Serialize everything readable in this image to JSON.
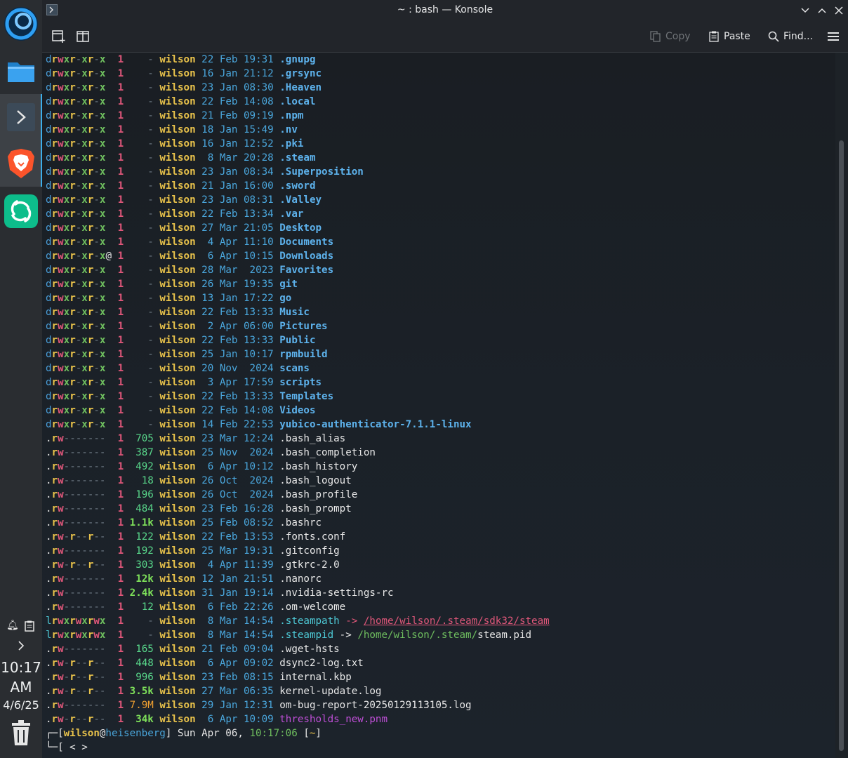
{
  "window": {
    "title": "~ : bash — Konsole",
    "toolbar": {
      "copy": "Copy",
      "paste": "Paste",
      "find": "Find..."
    }
  },
  "panel": {
    "apps": [
      {
        "name": "Dolphin",
        "icon": "folder-icon"
      },
      {
        "name": "Konsole",
        "icon": "terminal-icon"
      },
      {
        "name": "Brave",
        "icon": "brave-lion-icon"
      },
      {
        "name": "Element",
        "icon": "element-icon"
      }
    ],
    "clock": {
      "time": "10:17",
      "ampm": "AM",
      "date": "4/6/25"
    }
  },
  "listing": [
    {
      "p": [
        "d",
        "rwx",
        "r-x",
        "r-x"
      ],
      "n": "1",
      "size": "-",
      "user": "wilson",
      "day": "22",
      "mon": "Feb",
      "time": "19:31",
      "name": ".gnupg",
      "t": "dir"
    },
    {
      "p": [
        "d",
        "rwx",
        "r-x",
        "r-x"
      ],
      "n": "1",
      "size": "-",
      "user": "wilson",
      "day": "16",
      "mon": "Jan",
      "time": "21:12",
      "name": ".grsync",
      "t": "dir"
    },
    {
      "p": [
        "d",
        "rwx",
        "r-x",
        "r-x"
      ],
      "n": "1",
      "size": "-",
      "user": "wilson",
      "day": "23",
      "mon": "Jan",
      "time": "08:30",
      "name": ".Heaven",
      "t": "dir"
    },
    {
      "p": [
        "d",
        "rwx",
        "r-x",
        "r-x"
      ],
      "n": "1",
      "size": "-",
      "user": "wilson",
      "day": "22",
      "mon": "Feb",
      "time": "14:08",
      "name": ".local",
      "t": "dir"
    },
    {
      "p": [
        "d",
        "rwx",
        "r-x",
        "r-x"
      ],
      "n": "1",
      "size": "-",
      "user": "wilson",
      "day": "21",
      "mon": "Feb",
      "time": "09:19",
      "name": ".npm",
      "t": "dir"
    },
    {
      "p": [
        "d",
        "rwx",
        "r-x",
        "r-x"
      ],
      "n": "1",
      "size": "-",
      "user": "wilson",
      "day": "18",
      "mon": "Jan",
      "time": "15:49",
      "name": ".nv",
      "t": "dir"
    },
    {
      "p": [
        "d",
        "rwx",
        "r-x",
        "r-x"
      ],
      "n": "1",
      "size": "-",
      "user": "wilson",
      "day": "16",
      "mon": "Jan",
      "time": "12:52",
      "name": ".pki",
      "t": "dir"
    },
    {
      "p": [
        "d",
        "rwx",
        "r-x",
        "r-x"
      ],
      "n": "1",
      "size": "-",
      "user": "wilson",
      "day": " 8",
      "mon": "Mar",
      "time": "20:28",
      "name": ".steam",
      "t": "dir"
    },
    {
      "p": [
        "d",
        "rwx",
        "r-x",
        "r-x"
      ],
      "n": "1",
      "size": "-",
      "user": "wilson",
      "day": "23",
      "mon": "Jan",
      "time": "08:34",
      "name": ".Superposition",
      "t": "dir"
    },
    {
      "p": [
        "d",
        "rwx",
        "r-x",
        "r-x"
      ],
      "n": "1",
      "size": "-",
      "user": "wilson",
      "day": "21",
      "mon": "Jan",
      "time": "16:00",
      "name": ".sword",
      "t": "dir"
    },
    {
      "p": [
        "d",
        "rwx",
        "r-x",
        "r-x"
      ],
      "n": "1",
      "size": "-",
      "user": "wilson",
      "day": "23",
      "mon": "Jan",
      "time": "08:31",
      "name": ".Valley",
      "t": "dir"
    },
    {
      "p": [
        "d",
        "rwx",
        "r-x",
        "r-x"
      ],
      "n": "1",
      "size": "-",
      "user": "wilson",
      "day": "22",
      "mon": "Feb",
      "time": "13:34",
      "name": ".var",
      "t": "dir"
    },
    {
      "p": [
        "d",
        "rwx",
        "r-x",
        "r-x"
      ],
      "n": "1",
      "size": "-",
      "user": "wilson",
      "day": "27",
      "mon": "Mar",
      "time": "21:05",
      "name": "Desktop",
      "t": "dir"
    },
    {
      "p": [
        "d",
        "rwx",
        "r-x",
        "r-x"
      ],
      "n": "1",
      "size": "-",
      "user": "wilson",
      "day": " 4",
      "mon": "Apr",
      "time": "11:10",
      "name": "Documents",
      "t": "dir"
    },
    {
      "p": [
        "d",
        "rwx",
        "r-x",
        "r-x"
      ],
      "at": "@",
      "n": "1",
      "size": "-",
      "user": "wilson",
      "day": " 6",
      "mon": "Apr",
      "time": "10:15",
      "name": "Downloads",
      "t": "dir"
    },
    {
      "p": [
        "d",
        "rwx",
        "r-x",
        "r-x"
      ],
      "n": "1",
      "size": "-",
      "user": "wilson",
      "day": "28",
      "mon": "Mar",
      "time": " 2023",
      "name": "Favorites",
      "t": "dir"
    },
    {
      "p": [
        "d",
        "rwx",
        "r-x",
        "r-x"
      ],
      "n": "1",
      "size": "-",
      "user": "wilson",
      "day": "26",
      "mon": "Mar",
      "time": "19:35",
      "name": "git",
      "t": "dir"
    },
    {
      "p": [
        "d",
        "rwx",
        "r-x",
        "r-x"
      ],
      "n": "1",
      "size": "-",
      "user": "wilson",
      "day": "13",
      "mon": "Jan",
      "time": "17:22",
      "name": "go",
      "t": "dir"
    },
    {
      "p": [
        "d",
        "rwx",
        "r-x",
        "r-x"
      ],
      "n": "1",
      "size": "-",
      "user": "wilson",
      "day": "22",
      "mon": "Feb",
      "time": "13:33",
      "name": "Music",
      "t": "dir"
    },
    {
      "p": [
        "d",
        "rwx",
        "r-x",
        "r-x"
      ],
      "n": "1",
      "size": "-",
      "user": "wilson",
      "day": " 2",
      "mon": "Apr",
      "time": "06:00",
      "name": "Pictures",
      "t": "dir"
    },
    {
      "p": [
        "d",
        "rwx",
        "r-x",
        "r-x"
      ],
      "n": "1",
      "size": "-",
      "user": "wilson",
      "day": "22",
      "mon": "Feb",
      "time": "13:33",
      "name": "Public",
      "t": "dir"
    },
    {
      "p": [
        "d",
        "rwx",
        "r-x",
        "r-x"
      ],
      "n": "1",
      "size": "-",
      "user": "wilson",
      "day": "25",
      "mon": "Jan",
      "time": "10:17",
      "name": "rpmbuild",
      "t": "dir"
    },
    {
      "p": [
        "d",
        "rwx",
        "r-x",
        "r-x"
      ],
      "n": "1",
      "size": "-",
      "user": "wilson",
      "day": "20",
      "mon": "Nov",
      "time": " 2024",
      "name": "scans",
      "t": "dir"
    },
    {
      "p": [
        "d",
        "rwx",
        "r-x",
        "r-x"
      ],
      "n": "1",
      "size": "-",
      "user": "wilson",
      "day": " 3",
      "mon": "Apr",
      "time": "17:59",
      "name": "scripts",
      "t": "dir"
    },
    {
      "p": [
        "d",
        "rwx",
        "r-x",
        "r-x"
      ],
      "n": "1",
      "size": "-",
      "user": "wilson",
      "day": "22",
      "mon": "Feb",
      "time": "13:33",
      "name": "Templates",
      "t": "dir"
    },
    {
      "p": [
        "d",
        "rwx",
        "r-x",
        "r-x"
      ],
      "n": "1",
      "size": "-",
      "user": "wilson",
      "day": "22",
      "mon": "Feb",
      "time": "14:08",
      "name": "Videos",
      "t": "dir"
    },
    {
      "p": [
        "d",
        "rwx",
        "r-x",
        "r-x"
      ],
      "n": "1",
      "size": "-",
      "user": "wilson",
      "day": "14",
      "mon": "Feb",
      "time": "22:53",
      "name": "yubico-authenticator-7.1.1-linux",
      "t": "dir"
    },
    {
      "p": [
        ".",
        "rw-",
        "---",
        "---"
      ],
      "n": "1",
      "size": "705",
      "user": "wilson",
      "day": "23",
      "mon": "Mar",
      "time": "12:24",
      "name": ".bash_alias",
      "t": "file"
    },
    {
      "p": [
        ".",
        "rw-",
        "---",
        "---"
      ],
      "n": "1",
      "size": "387",
      "user": "wilson",
      "day": "25",
      "mon": "Nov",
      "time": " 2024",
      "name": ".bash_completion",
      "t": "file"
    },
    {
      "p": [
        ".",
        "rw-",
        "---",
        "---"
      ],
      "n": "1",
      "size": "492",
      "user": "wilson",
      "day": " 6",
      "mon": "Apr",
      "time": "10:12",
      "name": ".bash_history",
      "t": "file"
    },
    {
      "p": [
        ".",
        "rw-",
        "---",
        "---"
      ],
      "n": "1",
      "size": "18",
      "user": "wilson",
      "day": "26",
      "mon": "Oct",
      "time": " 2024",
      "name": ".bash_logout",
      "t": "file"
    },
    {
      "p": [
        ".",
        "rw-",
        "---",
        "---"
      ],
      "n": "1",
      "size": "196",
      "user": "wilson",
      "day": "26",
      "mon": "Oct",
      "time": " 2024",
      "name": ".bash_profile",
      "t": "file"
    },
    {
      "p": [
        ".",
        "rw-",
        "---",
        "---"
      ],
      "n": "1",
      "size": "484",
      "user": "wilson",
      "day": "23",
      "mon": "Feb",
      "time": "16:28",
      "name": ".bash_prompt",
      "t": "file"
    },
    {
      "p": [
        ".",
        "rw-",
        "---",
        "---"
      ],
      "n": "1",
      "size": "1.1k",
      "user": "wilson",
      "day": "25",
      "mon": "Feb",
      "time": "08:52",
      "name": ".bashrc",
      "t": "file",
      "sz": "k"
    },
    {
      "p": [
        ".",
        "rw-",
        "r--",
        "r--"
      ],
      "n": "1",
      "size": "122",
      "user": "wilson",
      "day": "22",
      "mon": "Feb",
      "time": "13:53",
      "name": ".fonts.conf",
      "t": "file"
    },
    {
      "p": [
        ".",
        "rw-",
        "---",
        "---"
      ],
      "n": "1",
      "size": "192",
      "user": "wilson",
      "day": "25",
      "mon": "Mar",
      "time": "19:31",
      "name": ".gitconfig",
      "t": "file"
    },
    {
      "p": [
        ".",
        "rw-",
        "r--",
        "r--"
      ],
      "n": "1",
      "size": "303",
      "user": "wilson",
      "day": " 4",
      "mon": "Apr",
      "time": "11:39",
      "name": ".gtkrc-2.0",
      "t": "file"
    },
    {
      "p": [
        ".",
        "rw-",
        "---",
        "---"
      ],
      "n": "1",
      "size": "12k",
      "user": "wilson",
      "day": "12",
      "mon": "Jan",
      "time": "21:51",
      "name": ".nanorc",
      "t": "file",
      "sz": "k"
    },
    {
      "p": [
        ".",
        "rw-",
        "---",
        "---"
      ],
      "n": "1",
      "size": "2.4k",
      "user": "wilson",
      "day": "31",
      "mon": "Jan",
      "time": "19:14",
      "name": ".nvidia-settings-rc",
      "t": "file",
      "sz": "k"
    },
    {
      "p": [
        ".",
        "rw-",
        "---",
        "---"
      ],
      "n": "1",
      "size": "12",
      "user": "wilson",
      "day": " 6",
      "mon": "Feb",
      "time": "22:26",
      "name": ".om-welcome",
      "t": "file"
    },
    {
      "p": [
        "l",
        "rwx",
        "rwx",
        "rwx"
      ],
      "n": "1",
      "size": "-",
      "user": "wilson",
      "day": " 8",
      "mon": "Mar",
      "time": "14:54",
      "name": ".steampath",
      "t": "link",
      "arrow": "->",
      "target": "/home/wilson/.steam/sdk32/steam",
      "broken": true
    },
    {
      "p": [
        "l",
        "rwx",
        "rwx",
        "rwx"
      ],
      "n": "1",
      "size": "-",
      "user": "wilson",
      "day": " 8",
      "mon": "Mar",
      "time": "14:54",
      "name": ".steampid",
      "t": "link",
      "arrow": "->",
      "target": "/home/wilson/.steam/",
      "target2": "steam.pid",
      "broken": false
    },
    {
      "p": [
        ".",
        "rw-",
        "---",
        "---"
      ],
      "n": "1",
      "size": "165",
      "user": "wilson",
      "day": "21",
      "mon": "Feb",
      "time": "09:04",
      "name": ".wget-hsts",
      "t": "file"
    },
    {
      "p": [
        ".",
        "rw-",
        "r--",
        "r--"
      ],
      "n": "1",
      "size": "448",
      "user": "wilson",
      "day": " 6",
      "mon": "Apr",
      "time": "09:02",
      "name": "dsync2-log.txt",
      "t": "file"
    },
    {
      "p": [
        ".",
        "rw-",
        "r--",
        "r--"
      ],
      "n": "1",
      "size": "996",
      "user": "wilson",
      "day": "23",
      "mon": "Feb",
      "time": "08:15",
      "name": "internal.kbp",
      "t": "file"
    },
    {
      "p": [
        ".",
        "rw-",
        "r--",
        "r--"
      ],
      "n": "1",
      "size": "3.5k",
      "user": "wilson",
      "day": "27",
      "mon": "Mar",
      "time": "06:35",
      "name": "kernel-update.log",
      "t": "file",
      "sz": "k"
    },
    {
      "p": [
        ".",
        "rw-",
        "---",
        "---"
      ],
      "n": "1",
      "size": "7.9M",
      "user": "wilson",
      "day": "29",
      "mon": "Jan",
      "time": "12:31",
      "name": "om-bug-report-20250129113105.log",
      "t": "file",
      "sz": "M"
    },
    {
      "p": [
        ".",
        "rw-",
        "r--",
        "r--"
      ],
      "n": "1",
      "size": "34k",
      "user": "wilson",
      "day": " 6",
      "mon": "Apr",
      "time": "10:09",
      "name": "thresholds_new.pnm",
      "t": "img",
      "sz": "k"
    }
  ],
  "prompt": {
    "line1_prefix": "┌─[",
    "user": "wilson",
    "at": "@",
    "host": "heisenberg",
    "mid": "] Sun Apr 06, ",
    "time": "10:17:06",
    "dir_open": " [",
    "dir": "~",
    "dir_close": "]",
    "line2": "└─[ < >"
  },
  "colors": {
    "accent": "#3daee9",
    "dir": "#5db2ec",
    "user": "#e8c24b"
  }
}
